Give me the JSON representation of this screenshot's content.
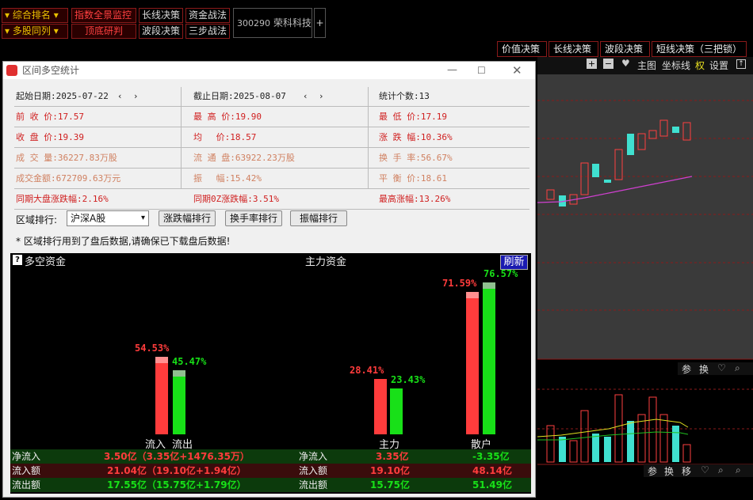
{
  "toolbar": {
    "r1": [
      "综合排名",
      "指数全景监控",
      "长线决策",
      "资金战法"
    ],
    "r2": [
      "多股同列",
      "顶底研判",
      "波段决策",
      "三步战法"
    ],
    "stock_code": "300290",
    "stock_name": "荣科科技",
    "plus": "+"
  },
  "right_tabs": [
    "价值决策",
    "长线决策",
    "波段决策",
    "短线决策（三把锁）"
  ],
  "chart_toolbar": {
    "main": "主图",
    "coord": "坐标线",
    "right": "权",
    "settings": "设置"
  },
  "sub_toolbar1": [
    "参",
    "换"
  ],
  "sub_toolbar2": [
    "参",
    "换",
    "移"
  ],
  "dialog": {
    "title": "区间多空统计",
    "start_label": "起始日期:2025-07-22",
    "end_label": "截止日期:2025-08-07",
    "count_label": "统计个数:13",
    "rows": [
      [
        "前 收 价:17.57",
        "最 高 价:19.90",
        "最 低 价:17.19"
      ],
      [
        "收 盘 价:19.39",
        "均　 价:18.57",
        "涨 跌 幅:10.36%"
      ],
      [
        "成 交 量:36227.83万股",
        "流 通 盘:63922.23万股",
        "换 手 率:56.67%"
      ],
      [
        "成交金额:672709.63万元",
        "振　  幅:15.42%",
        "平 衡 价:18.61"
      ],
      [
        "同期大盘涨跌幅:2.16%",
        "同期0Z涨跌幅:3.51%",
        "最高涨幅:13.26%"
      ]
    ],
    "region_label": "区域排行:",
    "region_value": "沪深A股",
    "btn_change": "涨跌幅排行",
    "btn_turnover": "换手率排行",
    "btn_amp": "振幅排行",
    "note": "* 区域排行用到了盘后数据,请确保已下载盘后数据!"
  },
  "panel": {
    "left_title": "多空资金",
    "center_title": "主力资金",
    "refresh": "刷新",
    "pct_in": "54.53%",
    "pct_out": "45.47%",
    "pct_main_in": "28.41%",
    "pct_main_out": "23.43%",
    "pct_retail_in": "71.59%",
    "pct_retail_out": "76.57%",
    "lbl_in": "流入",
    "lbl_out": "流出",
    "lbl_main": "主力",
    "lbl_retail": "散户",
    "table": [
      [
        "净流入",
        "3.50亿（3.35亿+1476.35万）",
        "净流入",
        "3.35亿",
        "-3.35亿"
      ],
      [
        "流入额",
        "21.04亿（19.10亿+1.94亿）",
        "流入额",
        "19.10亿",
        "48.14亿"
      ],
      [
        "流出额",
        "17.55亿（15.75亿+1.79亿）",
        "流出额",
        "15.75亿",
        "51.49亿"
      ]
    ]
  },
  "colors": {
    "red": "#ff3c3c",
    "green": "#18e018",
    "up": "#ff4040",
    "down": "#40e0d0"
  }
}
